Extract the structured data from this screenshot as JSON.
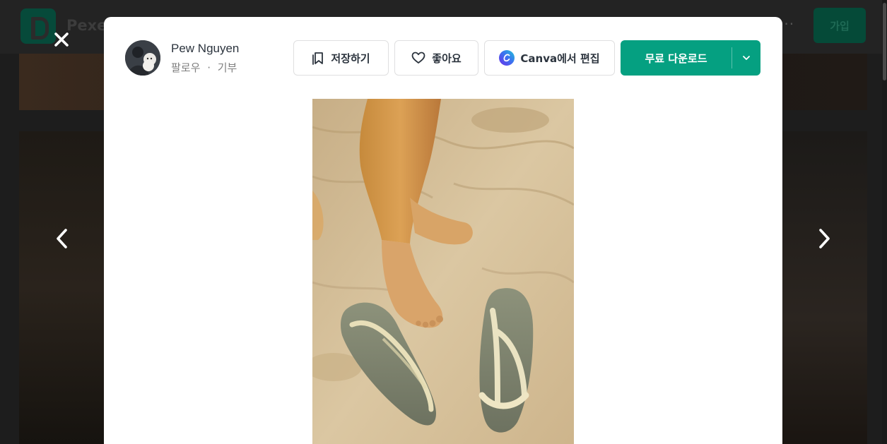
{
  "background": {
    "brand": "Pexels",
    "join_label": "가입",
    "more_label": "···"
  },
  "author": {
    "name": "Pew Nguyen",
    "follow_label": "팔로우",
    "separator": "·",
    "donate_label": "기부"
  },
  "actions": {
    "save_label": "저장하기",
    "like_label": "좋아요",
    "canva_label": "Canva에서 편집",
    "download_label": "무료 다운로드"
  },
  "colors": {
    "accent": "#05a081",
    "text": "#2c343e",
    "muted": "#7f7f7f"
  },
  "icons": {
    "close": "close-icon",
    "prev": "chevron-left-icon",
    "next": "chevron-right-icon",
    "save": "bookmark-icon",
    "like": "heart-icon",
    "canva": "canva-logo-icon",
    "download_menu": "chevron-down-icon"
  },
  "photo": {
    "subject": "photo"
  }
}
